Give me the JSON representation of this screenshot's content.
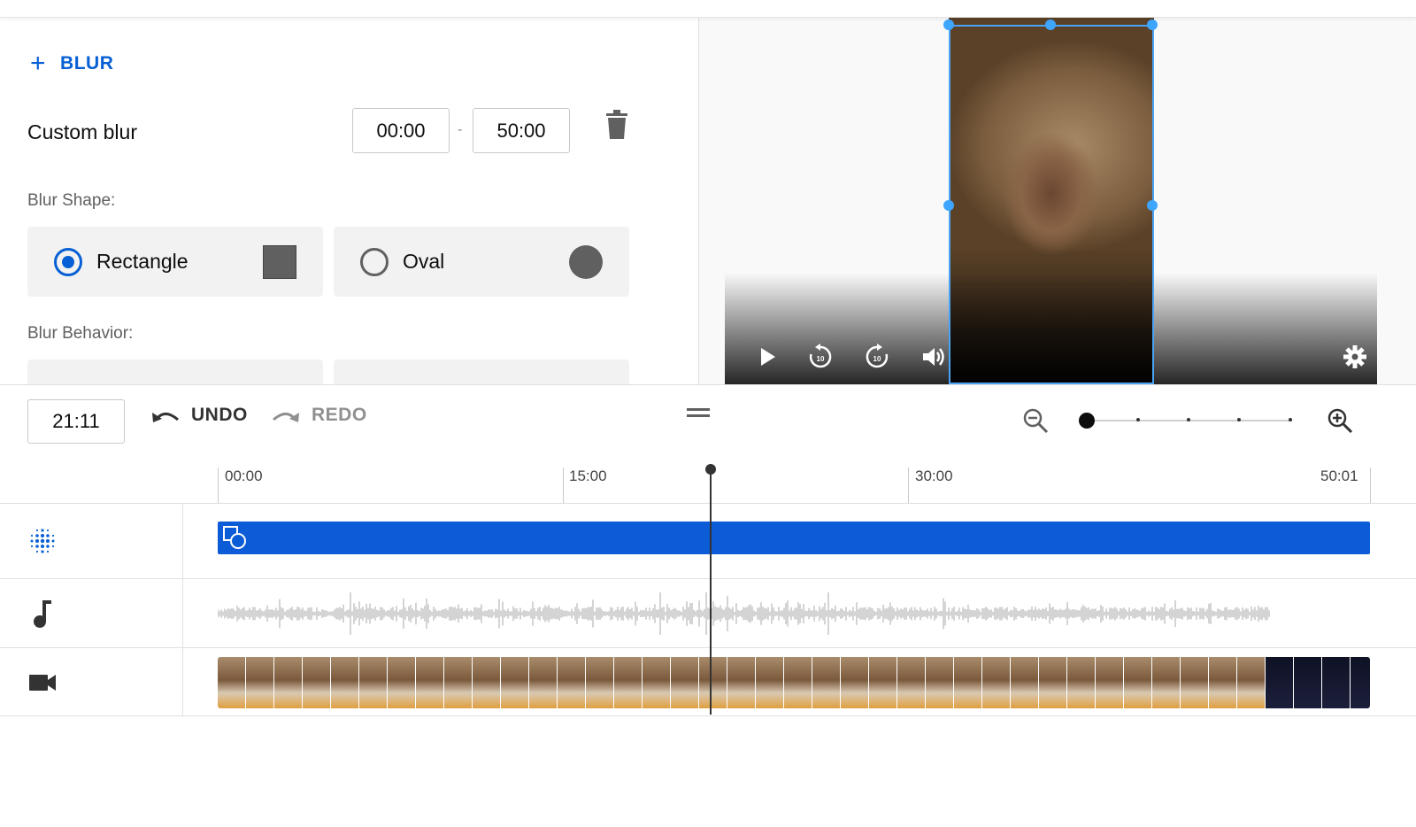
{
  "left_panel": {
    "add_blur_label": "BLUR",
    "blur_item": {
      "title": "Custom blur",
      "start_time": "00:00",
      "separator": "-",
      "end_time": "50:00"
    },
    "blur_shape_label": "Blur Shape:",
    "shapes": [
      {
        "label": "Rectangle",
        "selected": true
      },
      {
        "label": "Oval",
        "selected": false
      }
    ],
    "blur_behavior_label": "Blur Behavior:"
  },
  "toolbar": {
    "current_time": "21:11",
    "undo_label": "UNDO",
    "redo_label": "REDO"
  },
  "timeline": {
    "ticks": [
      "00:00",
      "15:00",
      "30:00",
      "50:01"
    ],
    "playhead_time": "21:11"
  },
  "colors": {
    "accent": "#065fd4",
    "blur_bar": "#0b5cd6",
    "handle": "#3ea6ff"
  },
  "icons": {
    "add": "plus-icon",
    "delete": "trash-icon",
    "play": "play-icon",
    "rewind": "rewind-10-icon",
    "forward": "forward-10-icon",
    "volume": "volume-icon",
    "settings": "gear-icon",
    "undo": "undo-icon",
    "redo": "redo-icon",
    "zoom_out": "zoom-out-icon",
    "zoom_in": "zoom-in-icon",
    "blur_track": "blur-dots-icon",
    "audio_track": "music-note-icon",
    "video_track": "video-camera-icon"
  }
}
